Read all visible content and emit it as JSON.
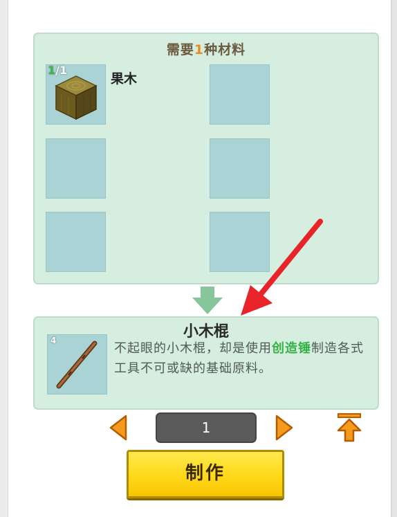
{
  "header": {
    "prefix": "需要",
    "count": "1",
    "suffix": "种材料"
  },
  "materials": [
    {
      "name": "果木",
      "have": "1",
      "need": "/1",
      "icon": "wood-block-icon"
    }
  ],
  "result": {
    "count": "4",
    "title": "小木棍",
    "desc_part1": "不起眼的小木棍，却是使用",
    "desc_highlight": "创造锤",
    "desc_part2": "制造各式工具不可或缺的基础原料。",
    "icon": "wooden-stick-icon"
  },
  "quantity": {
    "value": "1"
  },
  "craft_button": {
    "label": "制作"
  },
  "colors": {
    "panel_bg": "#d6eee0",
    "slot_bg": "#a9d3d4",
    "accent_orange": "#f08a1c",
    "highlight_green": "#34b244",
    "button_yellow": "#ffd91a",
    "annotation_red": "#e8232a"
  }
}
